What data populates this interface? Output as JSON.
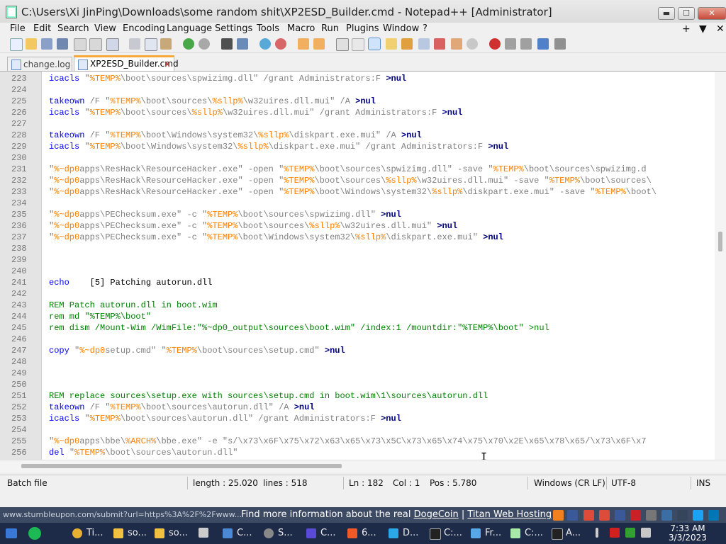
{
  "window": {
    "title": "C:\\Users\\Xi JinPing\\Downloads\\some random shit\\XP2ESD_Builder.cmd - Notepad++ [Administrator]",
    "min_label": "▬",
    "max_label": "☐",
    "close_label": "✕"
  },
  "menu": {
    "items": [
      "File",
      "Edit",
      "Search",
      "View",
      "Encoding",
      "Language",
      "Settings",
      "Tools",
      "Macro",
      "Run",
      "Plugins",
      "Window",
      "?"
    ],
    "right": [
      "+",
      "▼",
      "✕"
    ]
  },
  "tabs": [
    {
      "label": "change.log",
      "active": false
    },
    {
      "label": "XP2ESD_Builder.cmd",
      "active": true
    }
  ],
  "tab_close_label": "✕",
  "lines": [
    {
      "n": "223",
      "t": [
        [
          "icacls ",
          "kw"
        ],
        [
          "\"",
          "str"
        ],
        [
          "%TEMP%",
          "var"
        ],
        [
          "\\boot\\sources\\spwizimg.dll\" /grant Administrators:F ",
          "str"
        ],
        [
          ">nul",
          "op"
        ]
      ]
    },
    {
      "n": "224",
      "t": []
    },
    {
      "n": "225",
      "t": [
        [
          "takeown ",
          "kw"
        ],
        [
          "/F \"",
          "str"
        ],
        [
          "%TEMP%",
          "var"
        ],
        [
          "\\boot\\sources\\",
          "str"
        ],
        [
          "%sllp%",
          "var"
        ],
        [
          "\\w32uires.dll.mui\" /A ",
          "str"
        ],
        [
          ">nul",
          "op"
        ]
      ]
    },
    {
      "n": "226",
      "t": [
        [
          "icacls ",
          "kw"
        ],
        [
          "\"",
          "str"
        ],
        [
          "%TEMP%",
          "var"
        ],
        [
          "\\boot\\sources\\",
          "str"
        ],
        [
          "%sllp%",
          "var"
        ],
        [
          "\\w32uires.dll.mui\" /grant Administrators:F ",
          "str"
        ],
        [
          ">nul",
          "op"
        ]
      ]
    },
    {
      "n": "227",
      "t": []
    },
    {
      "n": "228",
      "t": [
        [
          "takeown ",
          "kw"
        ],
        [
          "/F \"",
          "str"
        ],
        [
          "%TEMP%",
          "var"
        ],
        [
          "\\boot\\Windows\\system32\\",
          "str"
        ],
        [
          "%sllp%",
          "var"
        ],
        [
          "\\diskpart.exe.mui\" /A ",
          "str"
        ],
        [
          ">nul",
          "op"
        ]
      ]
    },
    {
      "n": "229",
      "t": [
        [
          "icacls ",
          "kw"
        ],
        [
          "\"",
          "str"
        ],
        [
          "%TEMP%",
          "var"
        ],
        [
          "\\boot\\Windows\\system32\\",
          "str"
        ],
        [
          "%sllp%",
          "var"
        ],
        [
          "\\diskpart.exe.mui\" /grant Administrators:F ",
          "str"
        ],
        [
          ">nul",
          "op"
        ]
      ]
    },
    {
      "n": "230",
      "t": []
    },
    {
      "n": "231",
      "t": [
        [
          "\"",
          "str"
        ],
        [
          "%~dp0",
          "var"
        ],
        [
          "apps\\ResHack\\ResourceHacker.exe\" -open \"",
          "str"
        ],
        [
          "%TEMP%",
          "var"
        ],
        [
          "\\boot\\sources\\spwizimg.dll\" -save \"",
          "str"
        ],
        [
          "%TEMP%",
          "var"
        ],
        [
          "\\boot\\sources\\spwizimg.d",
          "str"
        ]
      ]
    },
    {
      "n": "232",
      "t": [
        [
          "\"",
          "str"
        ],
        [
          "%~dp0",
          "var"
        ],
        [
          "apps\\ResHack\\ResourceHacker.exe\" -open \"",
          "str"
        ],
        [
          "%TEMP%",
          "var"
        ],
        [
          "\\boot\\sources\\",
          "str"
        ],
        [
          "%sllp%",
          "var"
        ],
        [
          "\\w32uires.dll.mui\" -save \"",
          "str"
        ],
        [
          "%TEMP%",
          "var"
        ],
        [
          "\\boot\\sources\\",
          "str"
        ]
      ]
    },
    {
      "n": "233",
      "t": [
        [
          "\"",
          "str"
        ],
        [
          "%~dp0",
          "var"
        ],
        [
          "apps\\ResHack\\ResourceHacker.exe\" -open \"",
          "str"
        ],
        [
          "%TEMP%",
          "var"
        ],
        [
          "\\boot\\Windows\\system32\\",
          "str"
        ],
        [
          "%sllp%",
          "var"
        ],
        [
          "\\diskpart.exe.mui\" -save \"",
          "str"
        ],
        [
          "%TEMP%",
          "var"
        ],
        [
          "\\boot\\",
          "str"
        ]
      ]
    },
    {
      "n": "234",
      "t": []
    },
    {
      "n": "235",
      "t": [
        [
          "\"",
          "str"
        ],
        [
          "%~dp0",
          "var"
        ],
        [
          "apps\\PEChecksum.exe\" -c \"",
          "str"
        ],
        [
          "%TEMP%",
          "var"
        ],
        [
          "\\boot\\sources\\spwizimg.dll\" ",
          "str"
        ],
        [
          ">nul",
          "op"
        ]
      ]
    },
    {
      "n": "236",
      "t": [
        [
          "\"",
          "str"
        ],
        [
          "%~dp0",
          "var"
        ],
        [
          "apps\\PEChecksum.exe\" -c \"",
          "str"
        ],
        [
          "%TEMP%",
          "var"
        ],
        [
          "\\boot\\sources\\",
          "str"
        ],
        [
          "%sllp%",
          "var"
        ],
        [
          "\\w32uires.dll.mui\" ",
          "str"
        ],
        [
          ">nul",
          "op"
        ]
      ]
    },
    {
      "n": "237",
      "t": [
        [
          "\"",
          "str"
        ],
        [
          "%~dp0",
          "var"
        ],
        [
          "apps\\PEChecksum.exe\" -c \"",
          "str"
        ],
        [
          "%TEMP%",
          "var"
        ],
        [
          "\\boot\\Windows\\system32\\",
          "str"
        ],
        [
          "%sllp%",
          "var"
        ],
        [
          "\\diskpart.exe.mui\" ",
          "str"
        ],
        [
          ">nul",
          "op"
        ]
      ]
    },
    {
      "n": "238",
      "t": []
    },
    {
      "n": "239",
      "t": []
    },
    {
      "n": "240",
      "t": []
    },
    {
      "n": "241",
      "t": [
        [
          "echo ",
          "kw"
        ],
        [
          "   [5] Patching autorun.dll",
          "plain"
        ]
      ]
    },
    {
      "n": "242",
      "t": []
    },
    {
      "n": "243",
      "t": [
        [
          "REM Patch autorun.dll in boot.wim",
          "com"
        ]
      ]
    },
    {
      "n": "244",
      "t": [
        [
          "rem md \"%TEMP%\\boot\"",
          "com"
        ]
      ]
    },
    {
      "n": "245",
      "t": [
        [
          "rem dism /Mount-Wim /WimFile:\"%~dp0_output\\sources\\boot.wim\" /index:1 /mountdir:\"%TEMP%\\boot\" >nul",
          "com"
        ]
      ]
    },
    {
      "n": "246",
      "t": []
    },
    {
      "n": "247",
      "t": [
        [
          "copy ",
          "kw"
        ],
        [
          "\"",
          "str"
        ],
        [
          "%~dp0",
          "var"
        ],
        [
          "setup.cmd\" \"",
          "str"
        ],
        [
          "%TEMP%",
          "var"
        ],
        [
          "\\boot\\sources\\setup.cmd\" ",
          "str"
        ],
        [
          ">nul",
          "op"
        ]
      ]
    },
    {
      "n": "248",
      "t": []
    },
    {
      "n": "249",
      "t": []
    },
    {
      "n": "250",
      "t": []
    },
    {
      "n": "251",
      "t": [
        [
          "REM replace sources\\setup.exe with sources\\setup.cmd in boot.wim\\1\\sources\\autorun.dll",
          "com"
        ]
      ]
    },
    {
      "n": "252",
      "t": [
        [
          "takeown ",
          "kw"
        ],
        [
          "/F \"",
          "str"
        ],
        [
          "%TEMP%",
          "var"
        ],
        [
          "\\boot\\sources\\autorun.dll\" /A ",
          "str"
        ],
        [
          ">nul",
          "op"
        ]
      ]
    },
    {
      "n": "253",
      "t": [
        [
          "icacls ",
          "kw"
        ],
        [
          "\"",
          "str"
        ],
        [
          "%TEMP%",
          "var"
        ],
        [
          "\\boot\\sources\\autorun.dll\" /grant Administrators:F ",
          "str"
        ],
        [
          ">nul",
          "op"
        ]
      ]
    },
    {
      "n": "254",
      "t": []
    },
    {
      "n": "255",
      "t": [
        [
          "\"",
          "str"
        ],
        [
          "%~dp0",
          "var"
        ],
        [
          "apps\\bbe\\",
          "str"
        ],
        [
          "%ARCH%",
          "var"
        ],
        [
          "\\bbe.exe\" -e \"s/\\x73\\x6F\\x75\\x72\\x63\\x65\\x73\\x5C\\x73\\x65\\x74\\x75\\x70\\x2E\\x65\\x78\\x65/\\x73\\x6F\\x7",
          "str"
        ]
      ]
    },
    {
      "n": "256",
      "t": [
        [
          "del ",
          "kw"
        ],
        [
          "\"",
          "str"
        ],
        [
          "%TEMP%",
          "var"
        ],
        [
          "\\boot\\sources\\autorun.dll\"",
          "str"
        ]
      ]
    }
  ],
  "status": {
    "filetype": "Batch file",
    "length": "length : 25.020",
    "lines": "lines : 518",
    "ln": "Ln : 182",
    "col": "Col : 1",
    "pos": "Pos : 5.780",
    "eol": "Windows (CR LF)",
    "encoding": "UTF-8",
    "mode": "INS"
  },
  "adbar": {
    "url": "www.stumbleupon.com/submit?url=https%3A%2F%2Fwww...",
    "text_prefix": "Find more information about the real ",
    "link1": "DogeCoin",
    "separator": " | ",
    "link2": "Titan Web Hosting"
  },
  "taskbar": {
    "items": [
      "Ti...",
      "so...",
      "so...",
      "C...",
      "S...",
      "C...",
      "6...",
      "D...",
      "C:...",
      "Fr...",
      "C:...",
      "A..."
    ],
    "time": "7:33 AM",
    "date": "3/3/2023"
  },
  "colors": {
    "keyword": "#0000ff",
    "variable": "#ff8000",
    "string": "#808080",
    "operator": "#000080",
    "comment": "#008000",
    "active_tab_accent": "#f8a838"
  }
}
